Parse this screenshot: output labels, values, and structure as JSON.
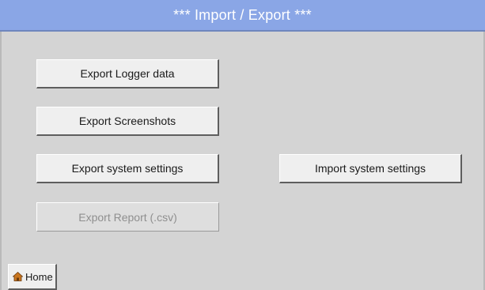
{
  "header": {
    "title": "***   Import / Export   ***"
  },
  "buttons": {
    "export_logger": "Export Logger data",
    "export_screenshots": "Export Screenshots",
    "export_system": "Export system settings",
    "import_system": "Import system settings",
    "export_report": "Export Report (.csv)"
  },
  "footer": {
    "home_label": "Home",
    "home_icon": "home-icon"
  },
  "colors": {
    "title_bar": "#8aa6e6",
    "background": "#d4d4d4",
    "button_face": "#efefef",
    "disabled_text": "#8f8f8f"
  }
}
